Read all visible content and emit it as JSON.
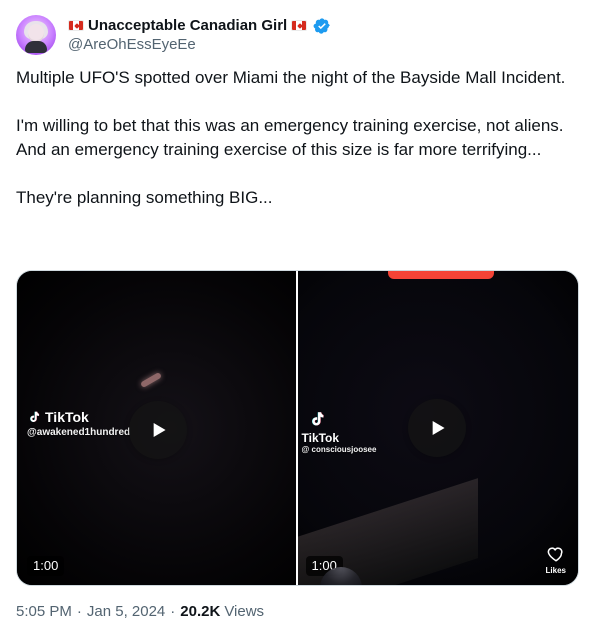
{
  "author": {
    "display_name": "Unacceptable Canadian Girl",
    "handle": "@AreOhEssEyeEe",
    "verified": true,
    "avatar_icon": "avatar-icon"
  },
  "tweet": {
    "text": "Multiple UFO'S spotted over Miami the night of the Bayside Mall Incident.\n\nI'm willing to bet that this was an emergency training exercise, not aliens. And an emergency training exercise of this size is far more terrifying...\n\nThey're planning something BIG..."
  },
  "media": {
    "videos": [
      {
        "tiktok_label": "TikTok",
        "tiktok_handle": "@awakened1hundred",
        "duration": "1:00"
      },
      {
        "tiktok_label": "TikTok",
        "tiktok_handle": "@ consciousjoosee",
        "duration": "1:00",
        "likes_label": "Likes"
      }
    ]
  },
  "meta": {
    "time": "5:05 PM",
    "separator": "·",
    "date": "Jan 5, 2024",
    "views_count": "20.2K",
    "views_label": "Views"
  },
  "colors": {
    "text_primary": "#0f1419",
    "text_secondary": "#536471",
    "verified_blue": "#1d9bf0",
    "canada_red": "#d52b1e",
    "tiktok_red_bar": "#f44336"
  }
}
